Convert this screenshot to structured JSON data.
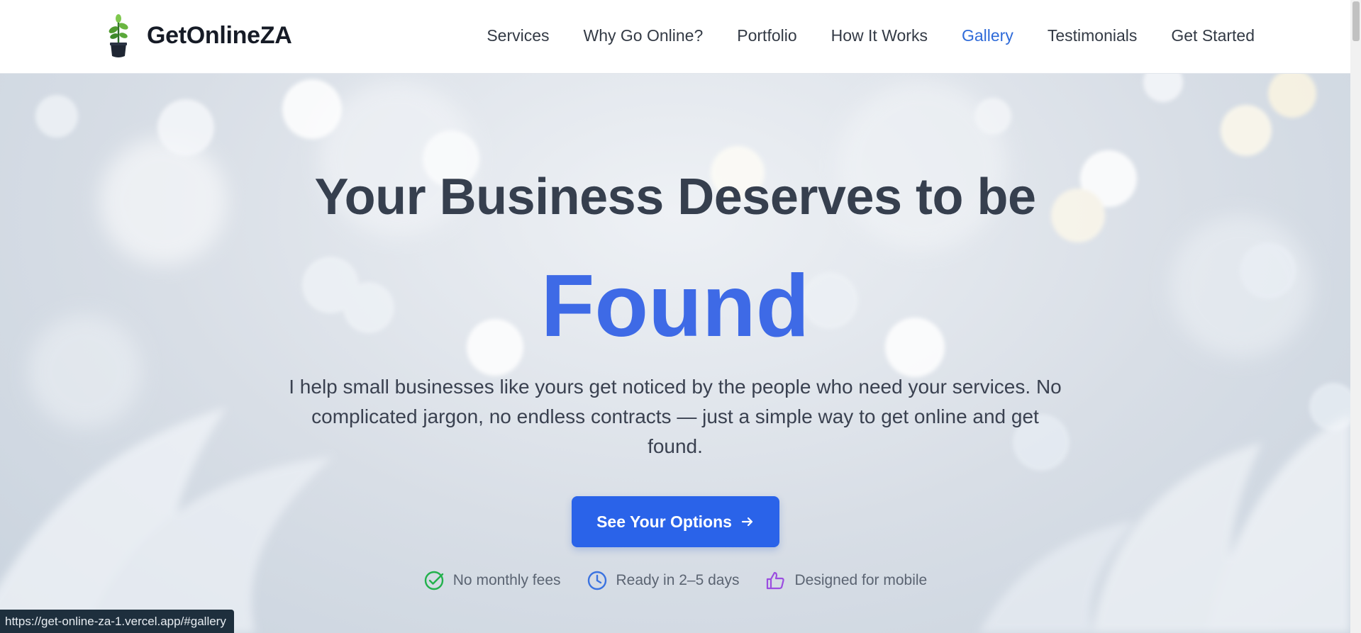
{
  "header": {
    "brand": "GetOnlineZA",
    "nav": [
      {
        "label": "Services"
      },
      {
        "label": "Why Go Online?"
      },
      {
        "label": "Portfolio"
      },
      {
        "label": "How It Works"
      },
      {
        "label": "Gallery",
        "active": true
      },
      {
        "label": "Testimonials"
      },
      {
        "label": "Get Started"
      }
    ]
  },
  "hero": {
    "headline": "Your Business Deserves to be",
    "highlight": "Found",
    "description": "I help small businesses like yours get noticed by the people who need your services. No complicated jargon, no endless contracts — just a simple way to get online and get found.",
    "cta_label": "See Your Options",
    "features": [
      {
        "label": "No monthly fees",
        "icon": "check-circle-icon",
        "color": "#22b14c"
      },
      {
        "label": "Ready in 2–5 days",
        "icon": "clock-icon",
        "color": "#3b73e0"
      },
      {
        "label": "Designed for mobile",
        "icon": "thumbs-up-icon",
        "color": "#9b4de0"
      }
    ]
  },
  "status_bar": {
    "url": "https://get-online-za-1.vercel.app/#gallery"
  },
  "colors": {
    "accent": "#3e6ae6",
    "button": "#2a63e9",
    "active_nav": "#2f6bd9"
  }
}
